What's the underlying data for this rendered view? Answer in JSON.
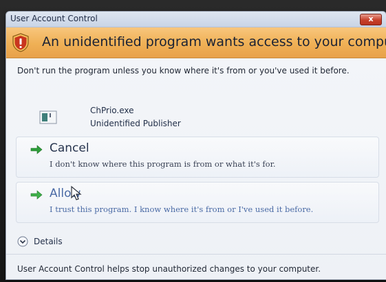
{
  "window": {
    "title": "User Account Control",
    "close_label": "x"
  },
  "banner": {
    "title": "An unidentified program wants access to your computer",
    "icon": "shield-warning-icon"
  },
  "warning": {
    "text": "Don't run the program unless you know where it's from or you've used it before."
  },
  "program": {
    "name": "ChPrio.exe",
    "publisher": "Unidentified Publisher",
    "icon": "program-icon"
  },
  "options": {
    "cancel": {
      "title": "Cancel",
      "description": "I don't know where this program is from or what it's for.",
      "icon": "green-arrow-icon"
    },
    "allow": {
      "title": "Allow",
      "description": "I trust this program. I know where it's from or I've used it before.",
      "icon": "green-arrow-icon"
    }
  },
  "details": {
    "label": "Details",
    "icon": "chevron-down-icon"
  },
  "footer": {
    "text": "User Account Control helps stop unauthorized changes to your computer."
  },
  "colors": {
    "banner": "#efb055",
    "accent_link": "#4a6aa5",
    "close_button": "#c7402b",
    "arrow": "#2e9e3a"
  }
}
